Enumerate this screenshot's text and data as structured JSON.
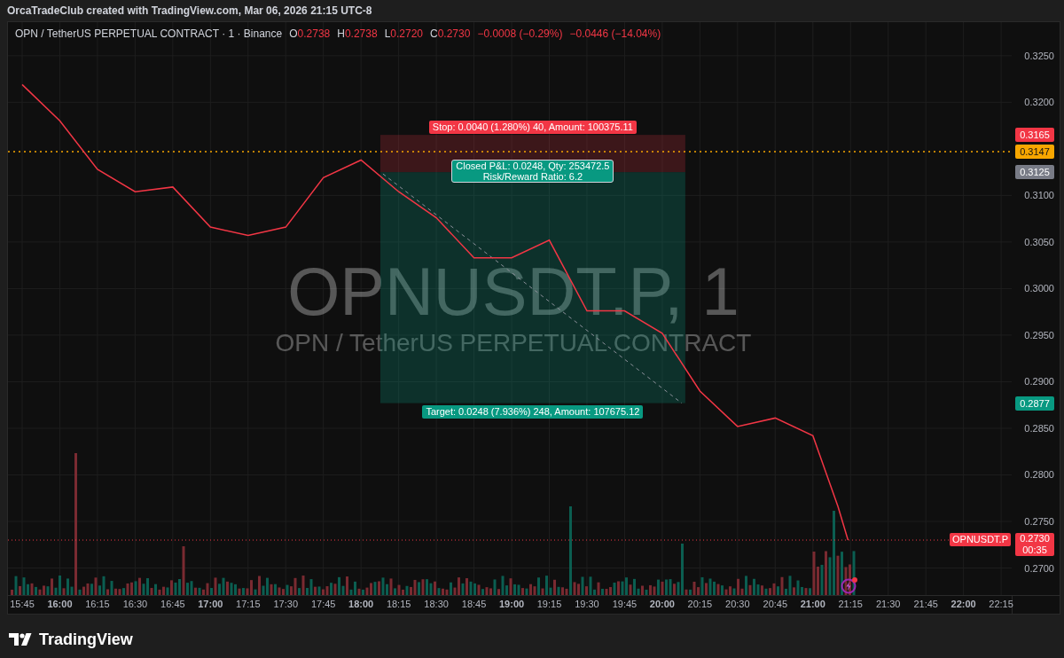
{
  "header": {
    "text": "OrcaTradeClub created with TradingView.com, Mar 06, 2026 21:15 UTC-8"
  },
  "legend": {
    "symbol": "OPN / TetherUS PERPETUAL CONTRACT · 1 · Binance",
    "ohlc": [
      {
        "label": "O",
        "value": "0.2738"
      },
      {
        "label": "H",
        "value": "0.2738"
      },
      {
        "label": "L",
        "value": "0.2720"
      },
      {
        "label": "C",
        "value": "0.2730"
      }
    ],
    "changes": [
      "−0.0008 (−0.29%)",
      "−0.0446 (−14.04%)"
    ]
  },
  "watermark": {
    "symbol": "OPNUSDT.P, 1",
    "description": "OPN / TetherUS PERPETUAL CONTRACT"
  },
  "position_tool": {
    "stop_label": "Stop: 0.0040 (1.280%) 40, Amount: 100375.11",
    "pnl_label": "Closed P&L: 0.0248, Qty: 253472.5",
    "ratio_label": "Risk/Reward Ratio: 6.2",
    "target_label": "Target: 0.0248 (7.936%) 248, Amount: 107675.12"
  },
  "price_badges": [
    {
      "kind": "stop",
      "text": "0.3165",
      "color": "#f23645"
    },
    {
      "kind": "alert",
      "text": "0.3147",
      "color": "#f7a600"
    },
    {
      "kind": "entry",
      "text": "0.3125",
      "color": "#787b86"
    },
    {
      "kind": "target",
      "text": "0.2877",
      "color": "#089981"
    },
    {
      "kind": "last",
      "text": "0.2730",
      "countdown": "00:35",
      "color": "#f23645"
    }
  ],
  "chart_data": {
    "type": "line",
    "x": [
      15.75,
      16,
      16.25,
      16.5,
      16.75,
      17,
      17.25,
      17.5,
      17.75,
      18,
      18.25,
      18.5,
      18.75,
      19,
      19.25,
      19.5,
      19.75,
      20,
      20.25,
      20.5,
      20.75,
      21,
      21.1667,
      21.2333
    ],
    "series": [
      {
        "name": "OPNUSDT.P",
        "color": "#f23645",
        "values": [
          0.3219,
          0.318,
          0.3128,
          0.3104,
          0.3109,
          0.3066,
          0.3057,
          0.3066,
          0.3119,
          0.3138,
          0.3104,
          0.3076,
          0.3033,
          0.3033,
          0.3052,
          0.2976,
          0.2976,
          0.2952,
          0.289,
          0.2852,
          0.2861,
          0.2842,
          0.2766,
          0.273
        ]
      }
    ],
    "xlim": [
      15.6558,
      22.638
    ],
    "ylim": [
      0.2671,
      0.3286
    ],
    "grid": true,
    "ref_lines": [
      {
        "axis": "y",
        "value": 0.3147,
        "color": "#f7a600"
      },
      {
        "axis": "y",
        "value": 0.273,
        "color": "#f23645"
      }
    ],
    "xticks": [
      {
        "value": 15.75,
        "label": "15:45"
      },
      {
        "value": 16,
        "label": "16:00"
      },
      {
        "value": 16.25,
        "label": "16:15"
      },
      {
        "value": 16.5,
        "label": "16:30"
      },
      {
        "value": 16.75,
        "label": "16:45"
      },
      {
        "value": 17,
        "label": "17:00"
      },
      {
        "value": 17.25,
        "label": "17:15"
      },
      {
        "value": 17.5,
        "label": "17:30"
      },
      {
        "value": 17.75,
        "label": "17:45"
      },
      {
        "value": 18,
        "label": "18:00"
      },
      {
        "value": 18.25,
        "label": "18:15"
      },
      {
        "value": 18.5,
        "label": "18:30"
      },
      {
        "value": 18.75,
        "label": "18:45"
      },
      {
        "value": 19,
        "label": "19:00"
      },
      {
        "value": 19.25,
        "label": "19:15"
      },
      {
        "value": 19.5,
        "label": "19:30"
      },
      {
        "value": 19.75,
        "label": "19:45"
      },
      {
        "value": 20,
        "label": "20:00"
      },
      {
        "value": 20.25,
        "label": "20:15"
      },
      {
        "value": 20.5,
        "label": "20:30"
      },
      {
        "value": 20.75,
        "label": "20:45"
      },
      {
        "value": 21,
        "label": "21:00"
      },
      {
        "value": 21.25,
        "label": "21:15"
      },
      {
        "value": 21.5,
        "label": "21:30"
      },
      {
        "value": 21.75,
        "label": "21:45"
      },
      {
        "value": 22,
        "label": "22:00"
      },
      {
        "value": 22.25,
        "label": "22:15"
      }
    ],
    "yticks": [
      {
        "value": 0.325,
        "label": "0.3250"
      },
      {
        "value": 0.32,
        "label": "0.3200"
      },
      {
        "value": 0.31,
        "label": "0.3100"
      },
      {
        "value": 0.305,
        "label": "0.3050"
      },
      {
        "value": 0.3,
        "label": "0.3000"
      },
      {
        "value": 0.295,
        "label": "0.2950"
      },
      {
        "value": 0.29,
        "label": "0.2900"
      },
      {
        "value": 0.285,
        "label": "0.2850"
      },
      {
        "value": 0.28,
        "label": "0.2800"
      },
      {
        "value": 0.275,
        "label": "0.2750"
      },
      {
        "value": 0.27,
        "label": "0.2700"
      }
    ]
  },
  "footer": {
    "brand": "TradingView"
  }
}
